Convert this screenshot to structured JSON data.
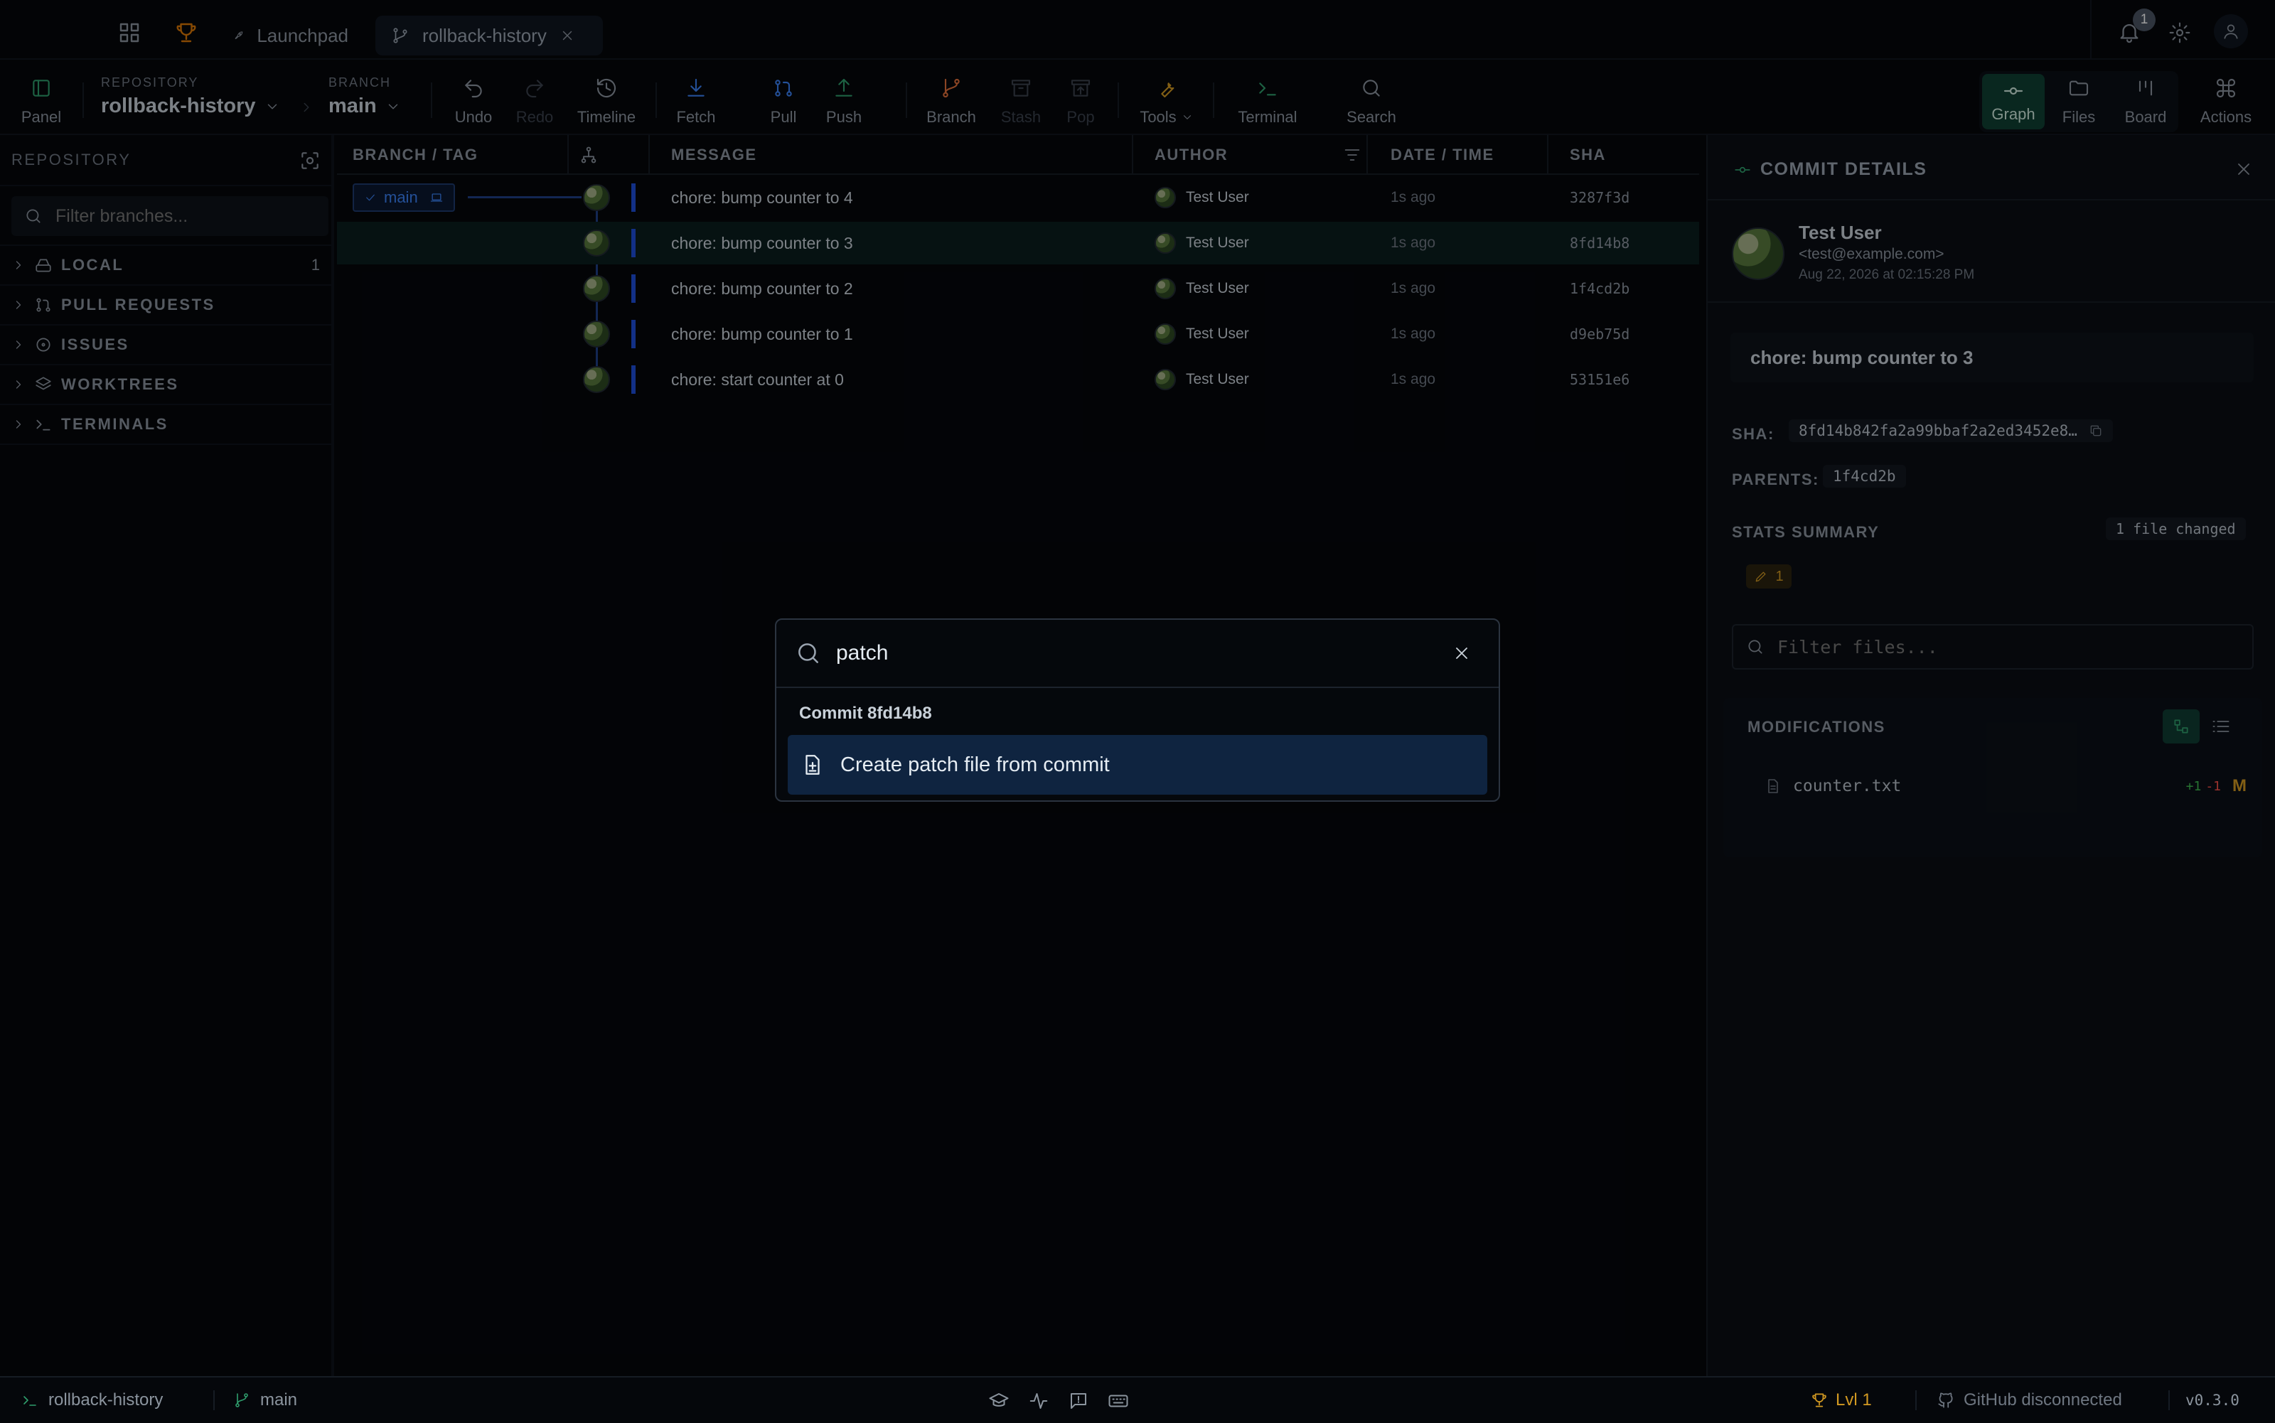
{
  "titlebar": {
    "tabs": [
      {
        "label": "Launchpad",
        "icon": "rocket-icon"
      },
      {
        "label": "rollback-history",
        "icon": "branch-icon"
      }
    ],
    "notifications_count": "1"
  },
  "toolbar": {
    "panel": "Panel",
    "repository_label": "REPOSITORY",
    "repository_value": "rollback-history",
    "branch_label": "BRANCH",
    "branch_value": "main",
    "undo": "Undo",
    "redo": "Redo",
    "timeline": "Timeline",
    "fetch": "Fetch",
    "pull": "Pull",
    "push": "Push",
    "branch": "Branch",
    "stash": "Stash",
    "pop": "Pop",
    "tools": "Tools",
    "terminal": "Terminal",
    "search": "Search",
    "graph": "Graph",
    "files": "Files",
    "board": "Board",
    "actions": "Actions"
  },
  "sidebar": {
    "title": "REPOSITORY",
    "filter_placeholder": "Filter branches...",
    "sections": [
      {
        "label": "LOCAL",
        "count": "1"
      },
      {
        "label": "PULL REQUESTS",
        "count": ""
      },
      {
        "label": "ISSUES",
        "count": ""
      },
      {
        "label": "WORKTREES",
        "count": ""
      },
      {
        "label": "TERMINALS",
        "count": ""
      }
    ]
  },
  "graph": {
    "columns": {
      "branch": "BRANCH / TAG",
      "message": "MESSAGE",
      "author": "AUTHOR",
      "date": "DATE / TIME",
      "sha": "SHA"
    },
    "branch_label": "main",
    "rows": [
      {
        "message": "chore: bump counter to 4",
        "author": "Test User",
        "date": "1s ago",
        "sha": "3287f3d"
      },
      {
        "message": "chore: bump counter to 3",
        "author": "Test User",
        "date": "1s ago",
        "sha": "8fd14b8"
      },
      {
        "message": "chore: bump counter to 2",
        "author": "Test User",
        "date": "1s ago",
        "sha": "1f4cd2b"
      },
      {
        "message": "chore: bump counter to 1",
        "author": "Test User",
        "date": "1s ago",
        "sha": "d9eb75d"
      },
      {
        "message": "chore: start counter at 0",
        "author": "Test User",
        "date": "1s ago",
        "sha": "53151e6"
      }
    ]
  },
  "details": {
    "title": "COMMIT DETAILS",
    "author_name": "Test User",
    "author_email": "<test@example.com>",
    "date": "Aug 22, 2026 at 02:15:28 PM",
    "message": "chore: bump counter to 3",
    "sha_label": "SHA:",
    "sha_value": "8fd14b842fa2a99bbaf2a2ed3452e8…",
    "parents_label": "PARENTS:",
    "parents_value": "1f4cd2b",
    "stats_label": "STATS SUMMARY",
    "files_changed": "1 file changed",
    "modified_count": "1",
    "filter_placeholder": "Filter files...",
    "modifications_label": "MODIFICATIONS",
    "files": [
      {
        "name": "counter.txt",
        "added": "+1",
        "removed": "-1",
        "status": "M"
      }
    ]
  },
  "palette": {
    "query": "patch",
    "group": "Commit 8fd14b8",
    "items": [
      {
        "label": "Create patch file from commit",
        "icon": "file-plus-icon"
      }
    ]
  },
  "statusbar": {
    "repo": "rollback-history",
    "branch": "main",
    "level": "Lvl 1",
    "github": "GitHub disconnected",
    "version": "v0.3.0"
  },
  "colors": {
    "accent": "#2f9e6d",
    "branch_blue": "#2563eb",
    "warning": "#d29922",
    "added": "#3fb950",
    "removed": "#f85149"
  }
}
